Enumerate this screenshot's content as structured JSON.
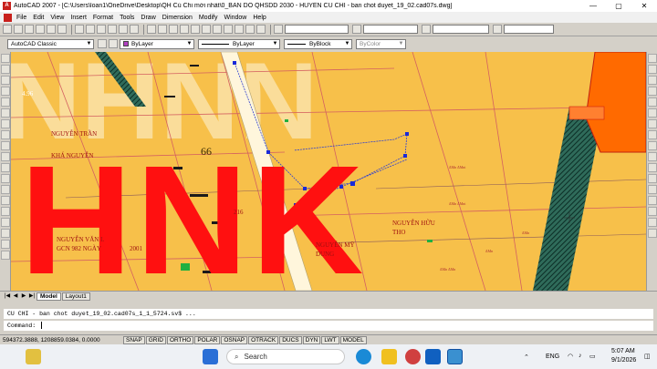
{
  "window": {
    "title": "AutoCAD 2007 - [C:\\Users\\loan1\\OneDrive\\Desktop\\QH Củ Chi mới nhất\\0_BAN DO QHSDD 2030 - HUYEN CU CHI - ban chot duyet_19_02.cad07s.dwg]",
    "minimize": "—",
    "maximize": "▢",
    "close": "✕"
  },
  "menu": [
    "File",
    "Edit",
    "View",
    "Insert",
    "Format",
    "Tools",
    "Draw",
    "Dimension",
    "Modify",
    "Window",
    "Help"
  ],
  "properties": {
    "workspace": "AutoCAD Classic",
    "color": "ByLayer",
    "linetype": "ByLayer",
    "lineweight": "ByBlock",
    "plotstyle": "ByColor",
    "color_swatch": "#b040c0"
  },
  "drawing": {
    "watermark": "HNK",
    "labels": [
      "NGUYỄN VĂN L",
      "GCN 982 NGÀY",
      "2001",
      "NGUYỄN HỮU",
      "THO",
      "NGUYỄN MỸ",
      "DUNG",
      "66",
      "216",
      "4.96",
      "NGUYỄN TRẦN",
      "KHÁ NGUYỄN"
    ],
    "colors": {
      "land": "#f7c04a",
      "watermark": "#ff1010",
      "hatch": "#1f5a4a",
      "orange": "#ff6a00"
    }
  },
  "tabs": {
    "model": "Model",
    "layout": "Layout1"
  },
  "command": {
    "history": "CU CHI - ban chot duyet_19_02.cad07s_1_1_5724.sv$ ...",
    "prompt": "Command:"
  },
  "status": {
    "coordinates": "594372.3888, 1208859.0384, 0.0000",
    "toggles": [
      "SNAP",
      "GRID",
      "ORTHO",
      "POLAR",
      "OSNAP",
      "OTRACK",
      "DUCS",
      "DYN",
      "LWT",
      "MODEL"
    ]
  },
  "taskbar": {
    "search": "Search",
    "language": "ENG",
    "time": "5:07 AM",
    "date": "9/1/2026"
  }
}
